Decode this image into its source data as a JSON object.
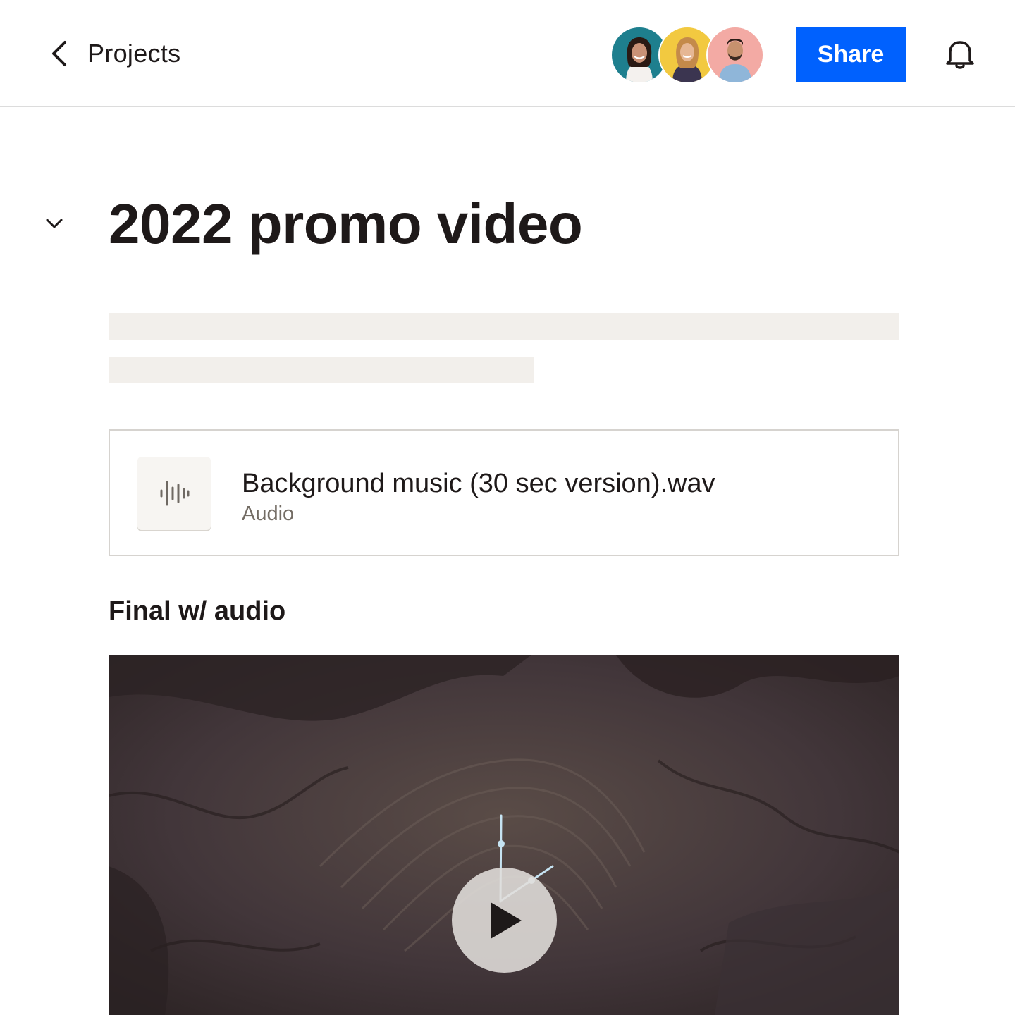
{
  "header": {
    "back_label": "Projects",
    "share_label": "Share",
    "icons": [
      "chevron-left-icon",
      "bell-icon"
    ],
    "accent_color": "#0061fe"
  },
  "project": {
    "title": "2022 promo video"
  },
  "attachment": {
    "file_name": "Background music (30 sec version).wav",
    "file_type": "Audio",
    "icon": "audio-waveform-icon"
  },
  "section": {
    "heading": "Final w/ audio"
  }
}
